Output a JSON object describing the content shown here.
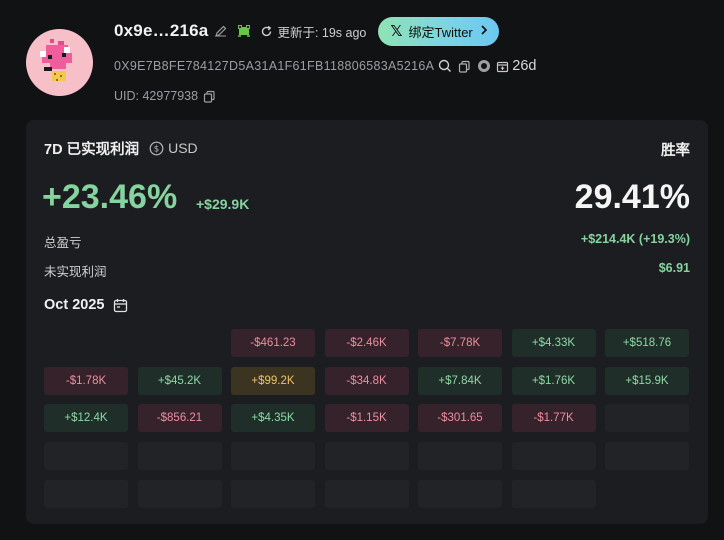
{
  "header": {
    "wallet_name": "0x9e…216a",
    "refresh_text": "更新于: 19s ago",
    "twitter_button": "绑定Twitter",
    "address": "0X9E7B8FE784127D5A31A1F61FB118806583A5216A",
    "age": "26d",
    "uid": "UID: 42977938"
  },
  "pnl": {
    "period_title": "7D 已实现利润",
    "currency": "USD",
    "pct": "+23.46%",
    "usd": "+$29.9K",
    "winrate_label": "胜率",
    "winrate": "29.41%",
    "total_label": "总盈亏",
    "total_value": "+$214.4K (+19.3%)",
    "unrealized_label": "未实现利润",
    "unrealized_value": "$6.91"
  },
  "calendar": {
    "month": "Oct 2025",
    "rows": [
      [
        "",
        "",
        "-$461.23",
        "-$2.46K",
        "-$7.78K",
        "+$4.33K",
        "+$518.76"
      ],
      [
        "-$1.78K",
        "+$45.2K",
        "+$99.2K",
        "-$34.8K",
        "+$7.84K",
        "+$1.76K",
        "+$15.9K"
      ],
      [
        "+$12.4K",
        "-$856.21",
        "+$4.35K",
        "-$1.15K",
        "-$301.65",
        "-$1.77K",
        ""
      ],
      [
        "",
        "",
        "",
        "",
        "",
        "",
        ""
      ],
      [
        "",
        "",
        "",
        "",
        "",
        ""
      ]
    ]
  },
  "colors": {
    "positive": "#86d39f",
    "negative": "#ee8e9f",
    "highlight": "#f0c26b",
    "accent_gradient": [
      "#8fe3b3",
      "#6cc7f0"
    ]
  },
  "icons": {
    "edit": "pencil-icon",
    "frog": "frog-icon",
    "refresh": "refresh-icon",
    "x_logo": "x-logo-icon",
    "chevron": "chevron-right-icon",
    "search": "search-icon",
    "copy": "copy-icon",
    "coin": "coin-icon",
    "wallet_created": "calendar-plus-icon",
    "currency_switch": "currency-switch-icon",
    "calendar": "calendar-icon"
  }
}
